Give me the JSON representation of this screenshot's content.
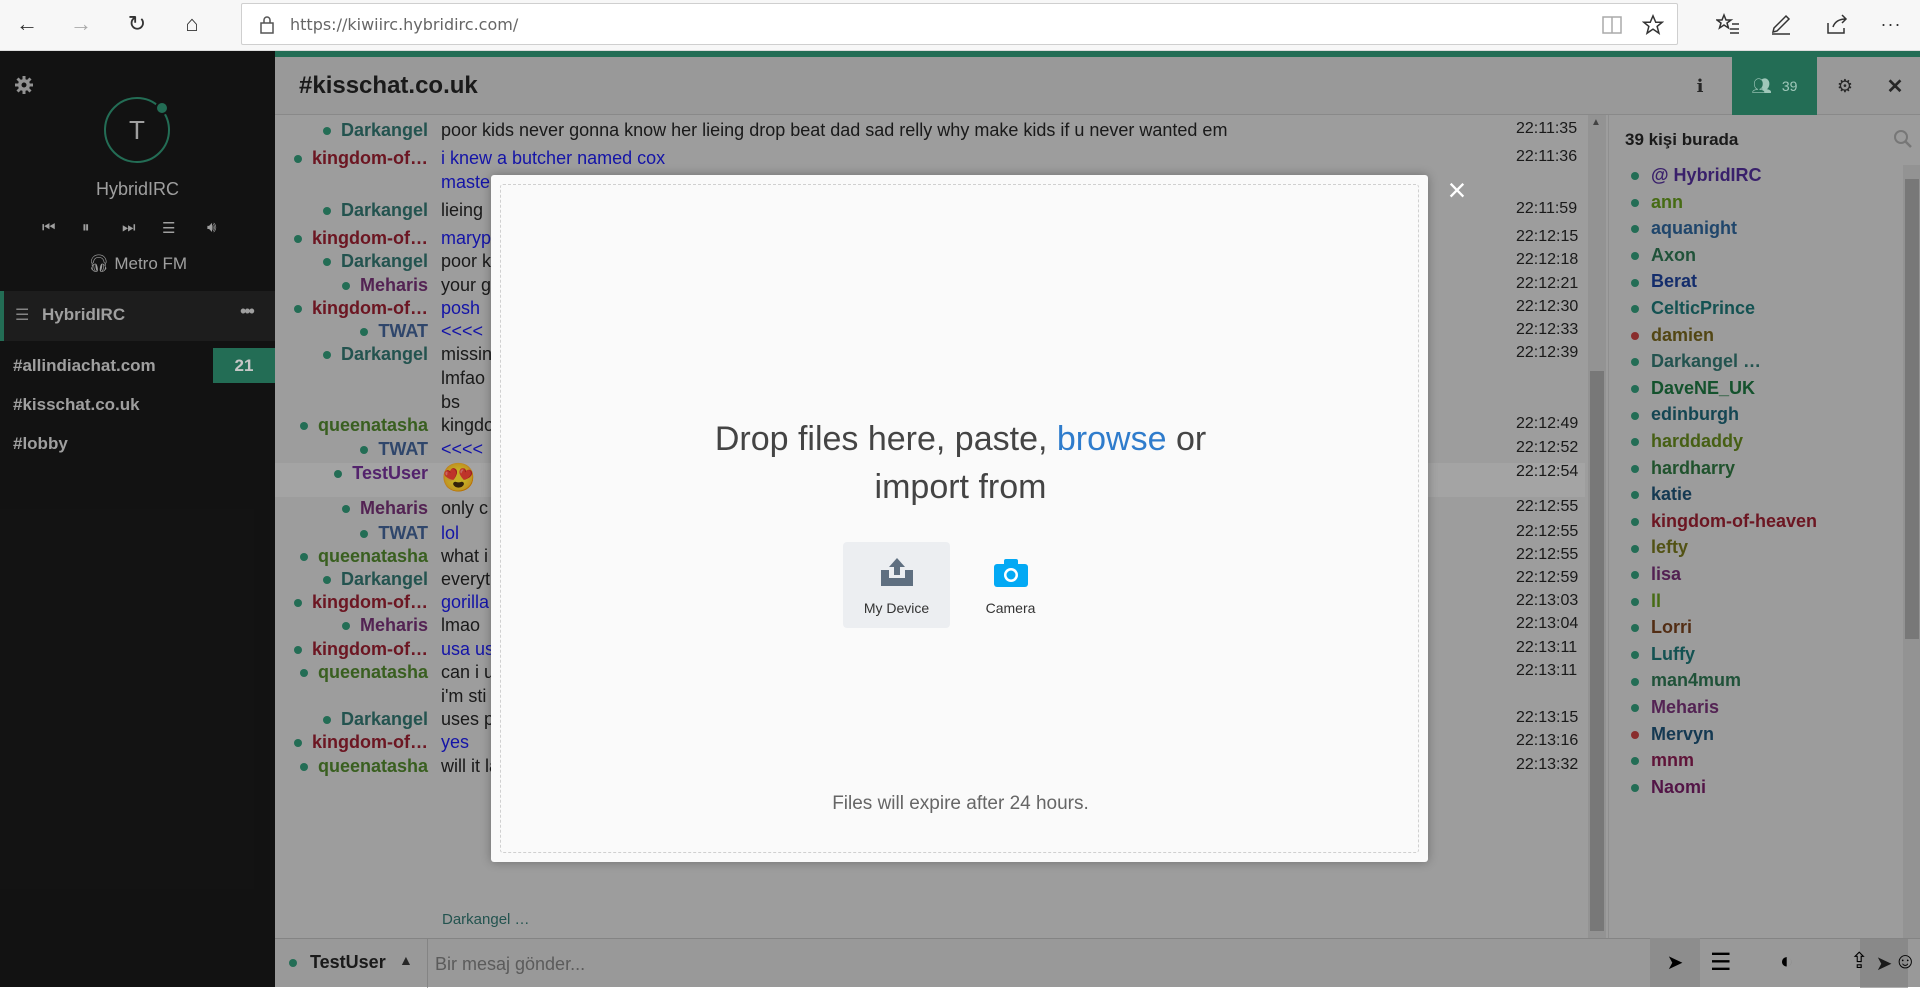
{
  "browser": {
    "url": "https://kiwiirc.hybridirc.com/",
    "back_icon": "←",
    "forward_icon": "→",
    "refresh_icon": "↻",
    "home_icon": "⌂",
    "more_label": "···"
  },
  "sidebar": {
    "avatar_letter": "T",
    "network_display": "HybridIRC",
    "radio_label": "Metro FM",
    "network_name": "HybridIRC",
    "channels": [
      {
        "name": "#allindiachat.com",
        "badge": "21"
      },
      {
        "name": "#kisschat.co.uk",
        "badge": ""
      },
      {
        "name": "#lobby",
        "badge": ""
      }
    ]
  },
  "header": {
    "channel": "#kisschat.co.uk",
    "user_count": "39"
  },
  "messages": [
    {
      "nick": "Darkangel",
      "color": "#2e6b66",
      "text": "poor kids never gonna know her lieing drop beat dad sad relly why make kids if u never wanted em",
      "time": "22:11:35",
      "textColor": "#222"
    },
    {
      "nick": "kingdom-of…",
      "color": "#8b1d2c",
      "text": "i knew  a butcher  named  cox",
      "time": "22:11:36",
      "textColor": "#1a1ad6"
    },
    {
      "nick": "",
      "color": "",
      "text": "maste",
      "time": "",
      "textColor": "#1a1ad6"
    },
    {
      "nick": "Darkangel",
      "color": "#2e6b66",
      "text": "lieing",
      "time": "22:11:59",
      "textColor": "#222"
    },
    {
      "nick": "kingdom-of…",
      "color": "#8b1d2c",
      "text": "maryp",
      "time": "22:12:15",
      "textColor": "#1a1ad6"
    },
    {
      "nick": "Darkangel",
      "color": "#2e6b66",
      "text": "poor k",
      "time": "22:12:18",
      "textColor": "#222"
    },
    {
      "nick": "Meharis",
      "color": "#6b2d6b",
      "text": "your g",
      "time": "22:12:21",
      "textColor": "#222"
    },
    {
      "nick": "kingdom-of…",
      "color": "#8b1d2c",
      "text": "posh",
      "time": "22:12:30",
      "textColor": "#1a1ad6"
    },
    {
      "nick": "TWAT",
      "color": "#3d5a8a",
      "text": "<<<<",
      "time": "22:12:33",
      "textColor": "#1a1ad6"
    },
    {
      "nick": "Darkangel",
      "color": "#2e6b66",
      "text": "missin",
      "time": "22:12:39",
      "textColor": "#222"
    },
    {
      "nick": "",
      "color": "",
      "text": "lmfao",
      "time": "",
      "textColor": "#222"
    },
    {
      "nick": "",
      "color": "",
      "text": "bs",
      "time": "",
      "textColor": "#222"
    },
    {
      "nick": "queenatasha",
      "color": "#4a7a2a",
      "text": "kingdo",
      "time": "22:12:49",
      "textColor": "#222"
    },
    {
      "nick": "TWAT",
      "color": "#3d5a8a",
      "text": "<<<<",
      "time": "22:12:52",
      "textColor": "#1a1ad6"
    },
    {
      "nick": "TestUser",
      "color": "#6b2d8b",
      "text": "😍",
      "time": "22:12:54",
      "textColor": "#222"
    },
    {
      "nick": "Meharis",
      "color": "#6b2d6b",
      "text": "only c",
      "time": "22:12:55",
      "textColor": "#222"
    },
    {
      "nick": "TWAT",
      "color": "#3d5a8a",
      "text": "lol",
      "time": "22:12:55",
      "textColor": "#1a1ad6"
    },
    {
      "nick": "queenatasha",
      "color": "#4a7a2a",
      "text": "what i",
      "time": "22:12:55",
      "textColor": "#222"
    },
    {
      "nick": "Darkangel",
      "color": "#2e6b66",
      "text": "everyt",
      "time": "22:12:59",
      "textColor": "#222"
    },
    {
      "nick": "kingdom-of…",
      "color": "#8b1d2c",
      "text": "gorilla",
      "time": "22:13:03",
      "textColor": "#1a1ad6"
    },
    {
      "nick": "Meharis",
      "color": "#6b2d6b",
      "text": "lmao",
      "time": "22:13:04",
      "textColor": "#222"
    },
    {
      "nick": "kingdom-of…",
      "color": "#8b1d2c",
      "text": "usa us",
      "time": "22:13:11",
      "textColor": "#1a1ad6"
    },
    {
      "nick": "queenatasha",
      "color": "#4a7a2a",
      "text": "can i u",
      "time": "22:13:11",
      "textColor": "#222"
    },
    {
      "nick": "",
      "color": "",
      "text": "i'm sti",
      "time": "",
      "textColor": "#222"
    },
    {
      "nick": "Darkangel",
      "color": "#2e6b66",
      "text": "uses p",
      "time": "22:13:15",
      "textColor": "#222"
    },
    {
      "nick": "kingdom-of…",
      "color": "#8b1d2c",
      "text": "yes",
      "time": "22:13:16",
      "textColor": "#1a1ad6"
    },
    {
      "nick": "queenatasha",
      "color": "#4a7a2a",
      "text": "will it last",
      "time": "22:13:32",
      "textColor": "#222"
    }
  ],
  "typing": "Darkangel …",
  "userlist": {
    "title": "39 kişi burada",
    "users": [
      {
        "name": "@ HybridIRC",
        "color": "#4a2a8a"
      },
      {
        "name": "ann",
        "color": "#5a8a1a"
      },
      {
        "name": "aquanight",
        "color": "#2a5a8a"
      },
      {
        "name": "Axon",
        "color": "#2a6a4a"
      },
      {
        "name": "Berat",
        "color": "#1a3a8a"
      },
      {
        "name": "CelticPrince",
        "color": "#1a6a6a"
      },
      {
        "name": "damien",
        "color": "#6a5a1a"
      },
      {
        "name": "Darkangel …",
        "color": "#2e6b66"
      },
      {
        "name": "DaveNE_UK",
        "color": "#1a6a3a"
      },
      {
        "name": "edinburgh",
        "color": "#1a5a6a"
      },
      {
        "name": "harddaddy",
        "color": "#5a7a1a"
      },
      {
        "name": "hardharry",
        "color": "#2a6a3a"
      },
      {
        "name": "katie",
        "color": "#1a4a6a"
      },
      {
        "name": "kingdom-of-heaven",
        "color": "#8b1d2c"
      },
      {
        "name": "lefty",
        "color": "#6a6a1a"
      },
      {
        "name": "lisa",
        "color": "#6a2a6a"
      },
      {
        "name": "ll",
        "color": "#5a8a1a"
      },
      {
        "name": "Lorri",
        "color": "#6a3a1a"
      },
      {
        "name": "Luffy",
        "color": "#1a6a6a"
      },
      {
        "name": "man4mum",
        "color": "#2a6a4a"
      },
      {
        "name": "Meharis",
        "color": "#6b2d6b"
      },
      {
        "name": "Mervyn",
        "color": "#1a4a6a"
      },
      {
        "name": "mnm",
        "color": "#7a1a4a"
      },
      {
        "name": "Naomi",
        "color": "#6a1a5a"
      }
    ]
  },
  "input": {
    "nick": "TestUser",
    "placeholder": "Bir mesaj gönder..."
  },
  "upload": {
    "drop_text_1": "Drop files here, paste,",
    "browse": "browse",
    "drop_text_2": "or",
    "drop_text_3": "import from",
    "my_device": "My Device",
    "camera": "Camera",
    "expire_note": "Files will expire after 24 hours.",
    "close": "×"
  }
}
